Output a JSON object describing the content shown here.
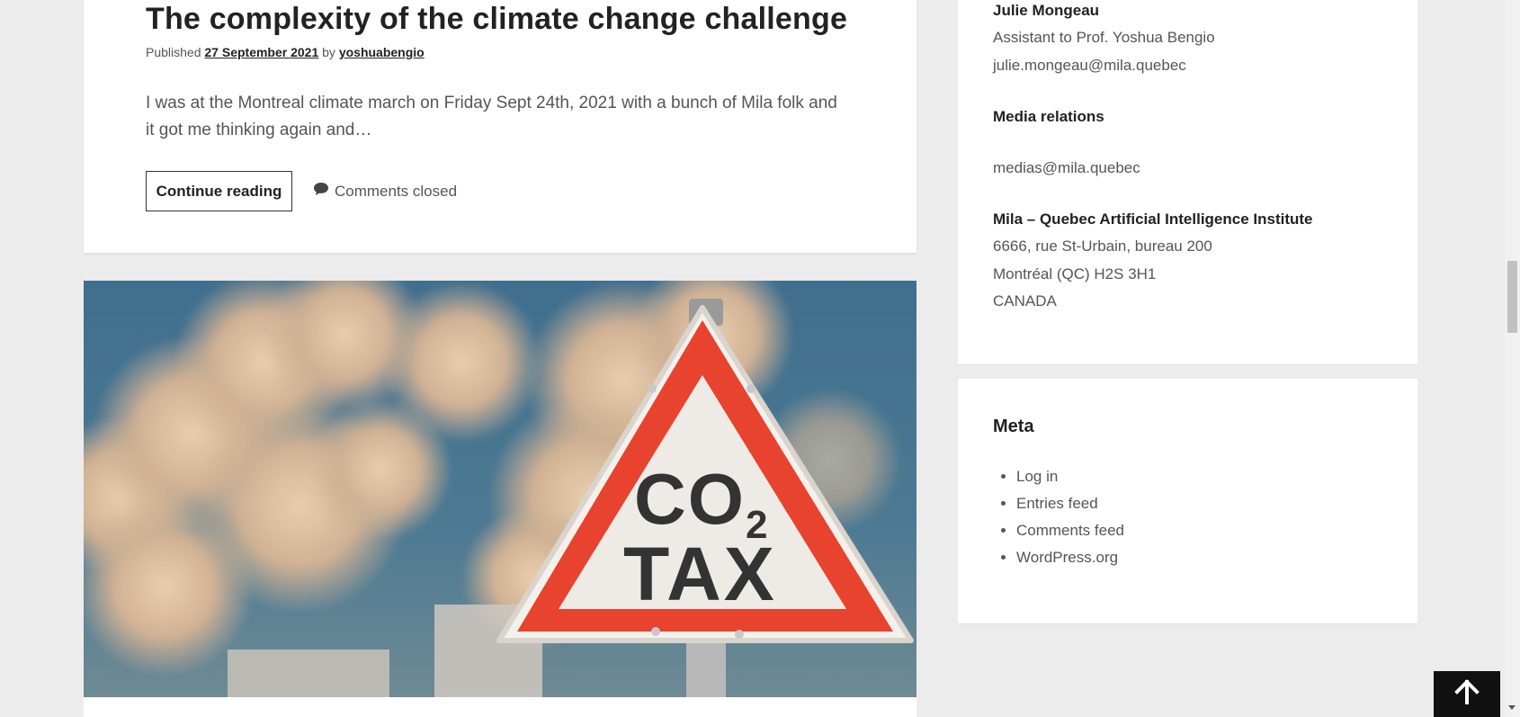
{
  "post": {
    "title": "The complexity of the climate change challenge",
    "published_prefix": "Published",
    "date": "27 September 2021",
    "by": "by",
    "author": "yoshuabengio",
    "excerpt": "I was at the Montreal climate march on Friday Sept 24th, 2021 with a bunch of Mila folk and it got me thinking again and…",
    "continue_label": "Continue reading",
    "comments_label": "Comments closed"
  },
  "featured_image": {
    "sign_line1": "CO",
    "sign_subscript": "2",
    "sign_line2": "TAX"
  },
  "sidebar": {
    "contact": {
      "name": "Julie Mongeau",
      "role": "Assistant to Prof. Yoshua Bengio",
      "email": "julie.mongeau@mila.quebec",
      "media_heading": "Media relations",
      "media_email": "medias@mila.quebec",
      "org_name": "Mila – Quebec Artificial Intelligence Institute",
      "address1": "6666, rue St-Urbain, bureau 200",
      "address2": "Montréal (QC) H2S 3H1",
      "country": "CANADA"
    },
    "meta": {
      "title": "Meta",
      "links": [
        "Log in",
        "Entries feed",
        "Comments feed",
        "WordPress.org"
      ]
    }
  },
  "icons": {
    "comment": "comment-bubble-icon",
    "back_to_top": "arrow-up-icon"
  },
  "colors": {
    "sign_red": "#e8432f",
    "background": "#ececec"
  }
}
